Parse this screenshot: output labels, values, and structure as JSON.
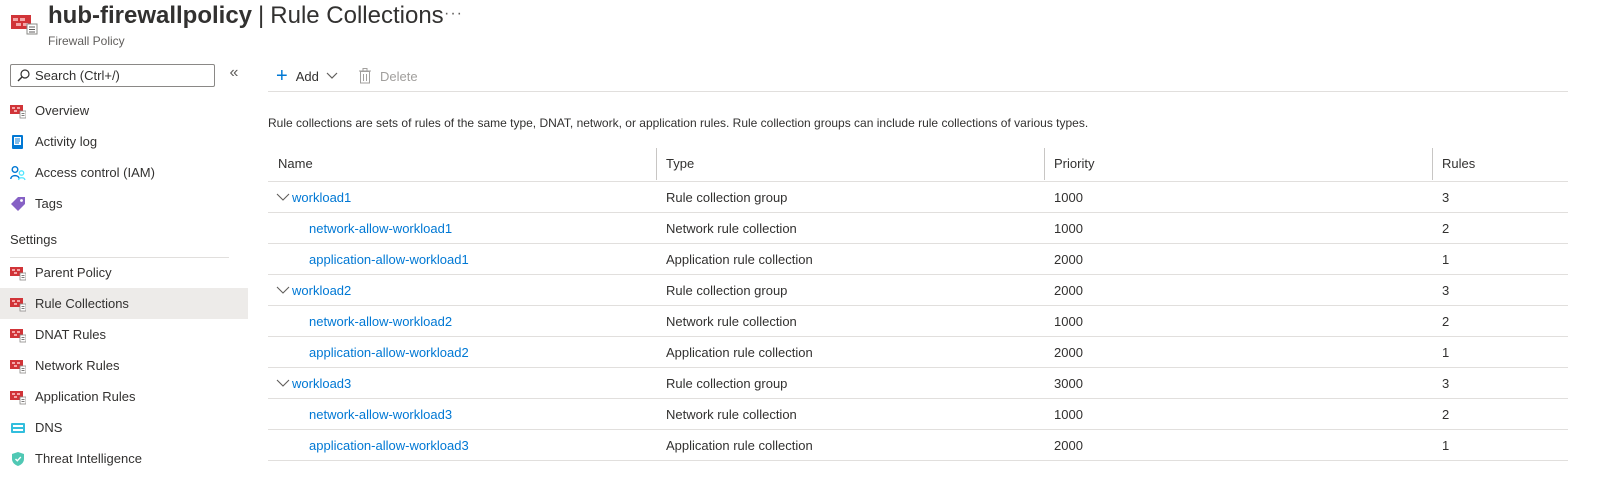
{
  "header": {
    "title": "hub-firewallpolicy",
    "separator": "|",
    "page": "Rule Collections",
    "more": "···",
    "subtitle": "Firewall Policy",
    "icon": "firewall-policy-icon"
  },
  "sidebar": {
    "search_placeholder": "Search (Ctrl+/)",
    "collapse_glyph": "«",
    "items_top": [
      {
        "label": "Overview",
        "icon": "firewall-policy-icon"
      },
      {
        "label": "Activity log",
        "icon": "activity-log-icon"
      },
      {
        "label": "Access control (IAM)",
        "icon": "people-icon"
      },
      {
        "label": "Tags",
        "icon": "tag-icon"
      }
    ],
    "section_settings": "Settings",
    "items_settings": [
      {
        "label": "Parent Policy",
        "icon": "firewall-policy-icon"
      },
      {
        "label": "Rule Collections",
        "icon": "firewall-policy-icon",
        "selected": true
      },
      {
        "label": "DNAT Rules",
        "icon": "firewall-policy-icon"
      },
      {
        "label": "Network Rules",
        "icon": "firewall-policy-icon"
      },
      {
        "label": "Application Rules",
        "icon": "firewall-policy-icon"
      },
      {
        "label": "DNS",
        "icon": "dns-icon"
      },
      {
        "label": "Threat Intelligence",
        "icon": "shield-icon"
      }
    ]
  },
  "toolbar": {
    "add_label": "Add",
    "delete_label": "Delete"
  },
  "main": {
    "description": "Rule collections are sets of rules of the same type, DNAT, network, or application rules. Rule collection groups can include rule collections of various types.",
    "columns": [
      "Name",
      "Type",
      "Priority",
      "Rules"
    ],
    "rows": [
      {
        "name": "workload1",
        "type": "Rule collection group",
        "priority": "1000",
        "rules": "3",
        "group": true
      },
      {
        "name": "network-allow-workload1",
        "type": "Network rule collection",
        "priority": "1000",
        "rules": "2",
        "group": false
      },
      {
        "name": "application-allow-workload1",
        "type": "Application rule collection",
        "priority": "2000",
        "rules": "1",
        "group": false
      },
      {
        "name": "workload2",
        "type": "Rule collection group",
        "priority": "2000",
        "rules": "3",
        "group": true
      },
      {
        "name": "network-allow-workload2",
        "type": "Network rule collection",
        "priority": "1000",
        "rules": "2",
        "group": false
      },
      {
        "name": "application-allow-workload2",
        "type": "Application rule collection",
        "priority": "2000",
        "rules": "1",
        "group": false
      },
      {
        "name": "workload3",
        "type": "Rule collection group",
        "priority": "3000",
        "rules": "3",
        "group": true
      },
      {
        "name": "network-allow-workload3",
        "type": "Network rule collection",
        "priority": "1000",
        "rules": "2",
        "group": false
      },
      {
        "name": "application-allow-workload3",
        "type": "Application rule collection",
        "priority": "2000",
        "rules": "1",
        "group": false
      }
    ]
  },
  "colors": {
    "link": "#0078d4",
    "firewall_red": "#d13438",
    "selected_bg": "#edebe9"
  }
}
